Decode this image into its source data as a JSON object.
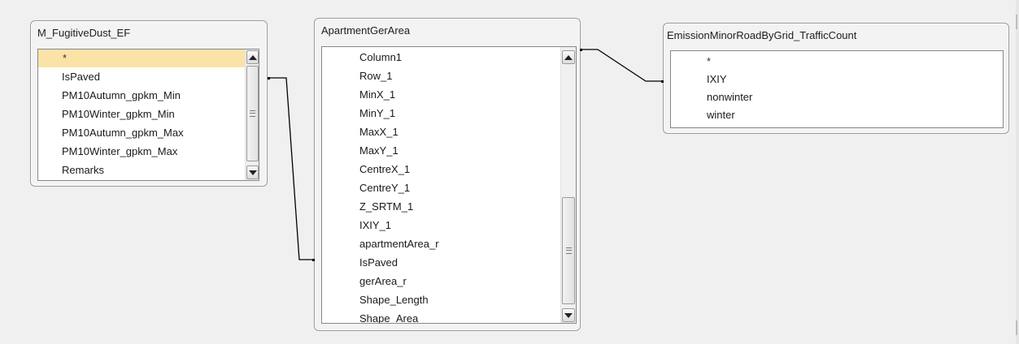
{
  "tables": [
    {
      "title": "M_FugitiveDust_EF",
      "fields": [
        "*",
        "IsPaved",
        "PM10Autumn_gpkm_Min",
        "PM10Winter_gpkm_Min",
        "PM10Autumn_gpkm_Max",
        "PM10Winter_gpkm_Max",
        "Remarks"
      ]
    },
    {
      "title": "ApartmentGerArea",
      "fields": [
        "Column1",
        "Row_1",
        "MinX_1",
        "MinY_1",
        "MaxX_1",
        "MaxY_1",
        "CentreX_1",
        "CentreY_1",
        "Z_SRTM_1",
        "IXIY_1",
        "apartmentArea_r",
        "IsPaved",
        "gerArea_r",
        "Shape_Length",
        "Shape_Area"
      ]
    },
    {
      "title": "EmissionMinorRoadByGrid_TrafficCount",
      "fields": [
        "*",
        "IXIY",
        "nonwinter",
        "winter"
      ]
    }
  ],
  "colors": {
    "selected_row": "#fbe3a7",
    "relationship_line": "#000000"
  }
}
